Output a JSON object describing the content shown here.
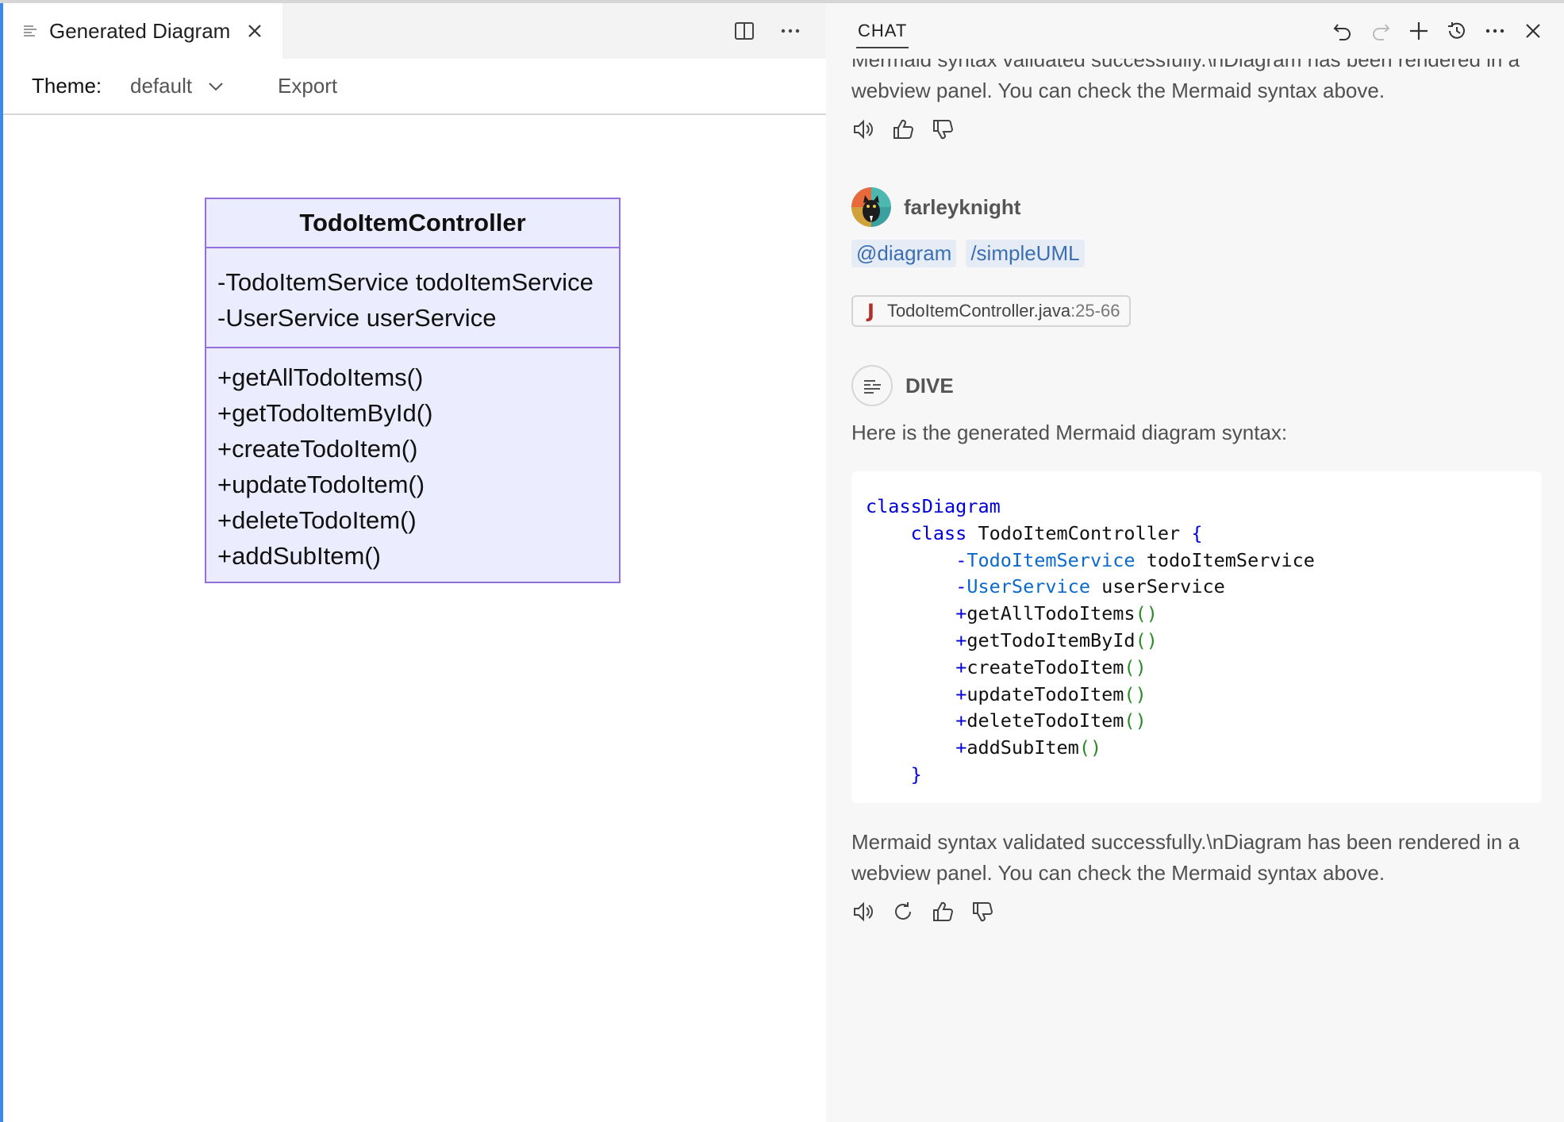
{
  "editor": {
    "tab_title": "Generated Diagram",
    "toolbar": {
      "theme_label": "Theme:",
      "theme_value": "default",
      "export_label": "Export"
    },
    "diagram": {
      "class_name": "TodoItemController",
      "fields": [
        "-TodoItemService todoItemService",
        "-UserService userService"
      ],
      "methods": [
        "+getAllTodoItems()",
        "+getTodoItemById()",
        "+createTodoItem()",
        "+updateTodoItem()",
        "+deleteTodoItem()",
        "+addSubItem()"
      ]
    }
  },
  "chat": {
    "tab_label": "CHAT",
    "previous_message": "Mermaid syntax validated successfully.\\nDiagram has been rendered in a webview panel. You can check the Mermaid syntax above.",
    "user": {
      "name": "farleyknight",
      "chips": [
        "@diagram",
        "/simpleUML"
      ],
      "file_reference": {
        "name": "TodoItemController.java",
        "range": ":25-66"
      }
    },
    "assistant": {
      "name": "DIVE",
      "intro": "Here is the generated Mermaid diagram syntax:",
      "code": {
        "line1": "classDiagram",
        "class_kw": "class",
        "class_name": "TodoItemController",
        "open_brace": "{",
        "close_brace": "}",
        "fields": [
          {
            "type": "TodoItemService",
            "name": "todoItemService"
          },
          {
            "type": "UserService",
            "name": "userService"
          }
        ],
        "methods": [
          "getAllTodoItems",
          "getTodoItemById",
          "createTodoItem",
          "updateTodoItem",
          "deleteTodoItem",
          "addSubItem"
        ]
      },
      "final_message": "Mermaid syntax validated successfully.\\nDiagram has been rendered in a webview panel. You can check the Mermaid syntax above."
    }
  }
}
